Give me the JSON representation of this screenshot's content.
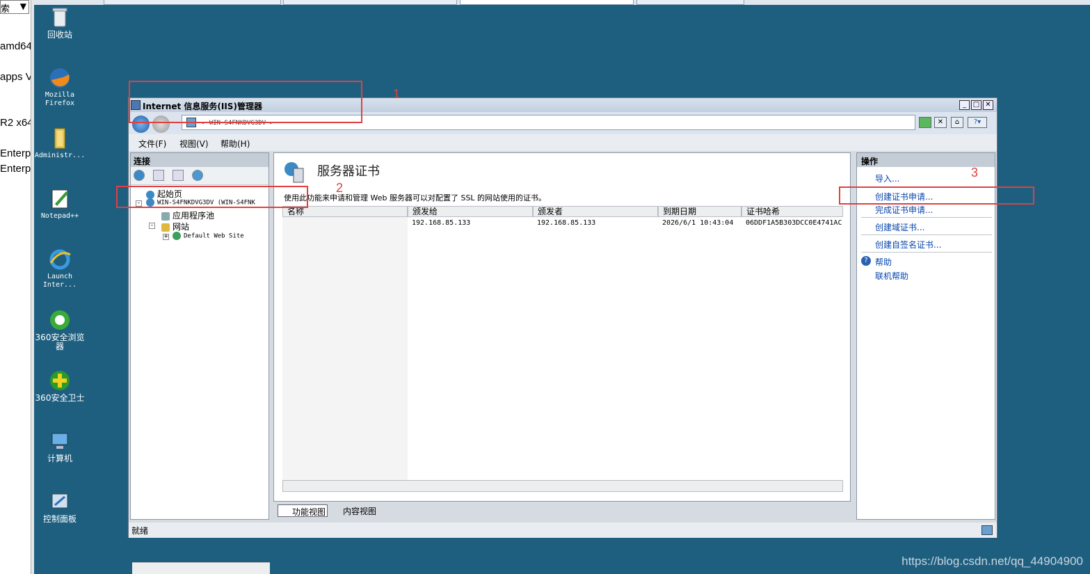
{
  "left_panel": {
    "search_label": "索",
    "lines": [
      "amd64",
      "apps V",
      "R2 x64",
      "Enterp",
      "Enterp"
    ]
  },
  "desktop": {
    "icons": [
      {
        "label": "回收站",
        "icon": "recycle-bin-icon"
      },
      {
        "label": "Mozilla\nFirefox",
        "icon": "firefox-icon"
      },
      {
        "label": "Administr...",
        "icon": "folder-icon"
      },
      {
        "label": "Notepad++",
        "icon": "notepad-icon"
      },
      {
        "label": "Launch\nInter...",
        "icon": "ie-icon"
      },
      {
        "label": "360安全浏览\n器",
        "icon": "360-browser-icon"
      },
      {
        "label": "360安全卫士",
        "icon": "360-guard-icon"
      },
      {
        "label": "计算机",
        "icon": "computer-icon"
      },
      {
        "label": "控制面板",
        "icon": "control-panel-icon"
      }
    ]
  },
  "window": {
    "title": "Internet 信息服务(IIS)管理器",
    "address": "▸ WIN-S4FNKDVG3DV ▸",
    "menus": [
      "文件(F)",
      "视图(V)",
      "帮助(H)"
    ],
    "status": "就绪"
  },
  "connections": {
    "header": "连接",
    "tree": {
      "start_page": "起始页",
      "server": "WIN-S4FNKDVG3DV (WIN-S4FNK",
      "app_pools": "应用程序池",
      "sites": "网站",
      "default_site": "Default Web Site"
    }
  },
  "content": {
    "title": "服务器证书",
    "description": "使用此功能来申请和管理 Web 服务器可以对配置了 SSL 的网站使用的证书。",
    "columns": [
      "名称",
      "颁发给",
      "颁发者",
      "到期日期",
      "证书哈希"
    ],
    "rows": [
      {
        "name": "",
        "issued_to": "192.168.85.133",
        "issuer": "192.168.85.133",
        "expiry": "2026/6/1 10:43:04",
        "hash": "06DDF1A5B303DCC0E4741AC"
      }
    ],
    "tabs": [
      "功能视图",
      "内容视图"
    ]
  },
  "actions": {
    "header": "操作",
    "items": [
      "导入...",
      "创建证书申请...",
      "完成证书申请...",
      "创建域证书...",
      "创建自签名证书..."
    ],
    "help": "帮助",
    "online_help": "联机帮助"
  },
  "annotations": [
    "1",
    "2",
    "3"
  ],
  "watermark": "https://blog.csdn.net/qq_44904900",
  "colors": {
    "desktop": "#1e5f80",
    "annotation": "#e04040",
    "link": "#0645ad"
  }
}
